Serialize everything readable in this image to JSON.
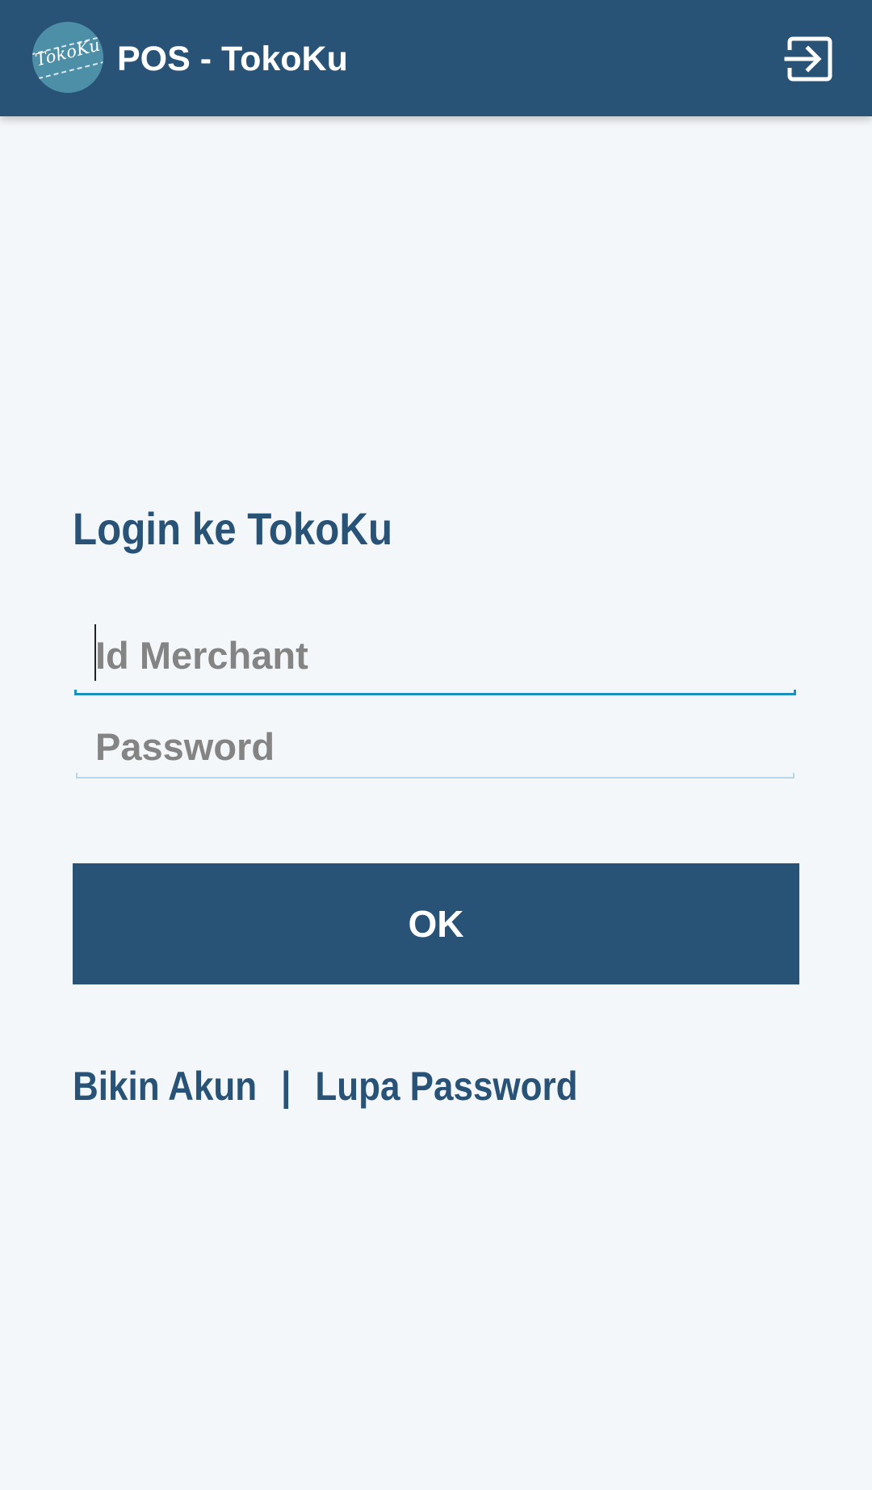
{
  "app_bar": {
    "logo_text": "TokoKu",
    "title": "POS - TokoKu",
    "login_icon": "login-icon"
  },
  "login_form": {
    "heading": "Login ke TokoKu",
    "merchant_field": {
      "placeholder": "Id Merchant",
      "value": ""
    },
    "password_field": {
      "placeholder": "Password",
      "value": ""
    },
    "submit_label": "OK"
  },
  "links": {
    "create_account": "Bikin Akun",
    "separator": "|",
    "forgot_password": "Lupa Password"
  },
  "colors": {
    "primary": "#285276",
    "background": "#f4f7fa",
    "focus_underline": "#1e90bd",
    "placeholder": "#848484",
    "logo_bg": "#4e8fa8"
  }
}
